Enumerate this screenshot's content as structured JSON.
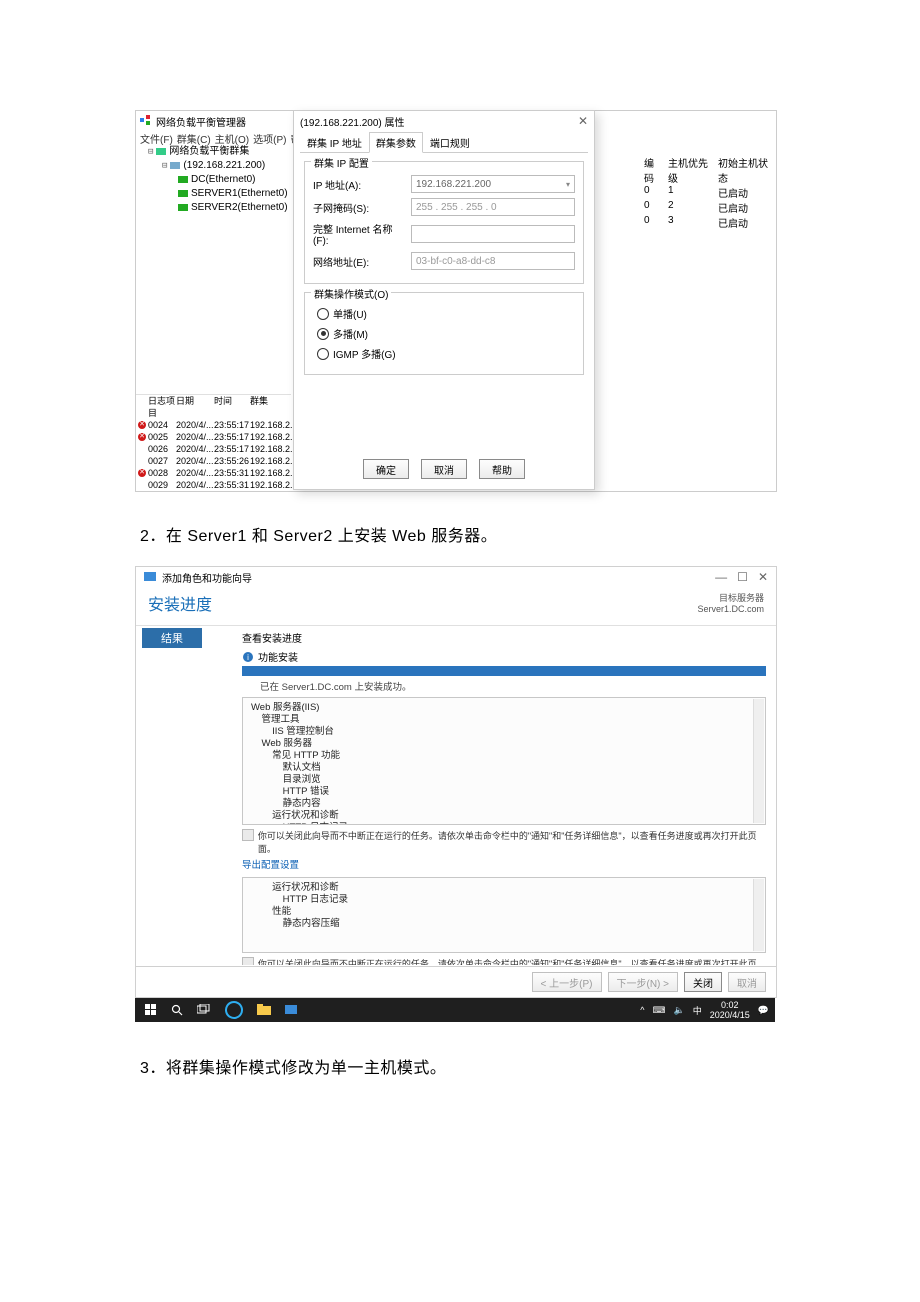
{
  "mgr": {
    "title": "网络负载平衡管理器",
    "menu": {
      "file": "文件(F)",
      "cluster": "群集(C)",
      "host": "主机(O)",
      "options": "选项(P)",
      "help": "帮助(H)"
    },
    "sys": {
      "min": "—",
      "max": "☐"
    },
    "tree": {
      "root": "网络负载平衡群集",
      "cluster_ip": "(192.168.221.200)",
      "hosts": [
        "DC(Ethernet0)",
        "SERVER1(Ethernet0)",
        "SERVER2(Ethernet0)"
      ]
    },
    "host_table": {
      "headers": {
        "code": "编码",
        "priority": "主机优先级",
        "status": "初始主机状态"
      },
      "rows": [
        {
          "code": "0",
          "priority": "1",
          "status": "已启动"
        },
        {
          "code": "0",
          "priority": "2",
          "status": "已启动"
        },
        {
          "code": "0",
          "priority": "3",
          "status": "已启动"
        }
      ]
    },
    "log": {
      "headers": {
        "entry": "日志项目",
        "date": "日期",
        "time": "时间",
        "cluster": "群集"
      },
      "rows": [
        {
          "err": true,
          "entry": "0024",
          "date": "2020/4/...",
          "time": "23:55:17",
          "cluster": "192.168.2..."
        },
        {
          "err": true,
          "entry": "0025",
          "date": "2020/4/...",
          "time": "23:55:17",
          "cluster": "192.168.2..."
        },
        {
          "err": false,
          "entry": "0026",
          "date": "2020/4/...",
          "time": "23:55:17",
          "cluster": "192.168.2..."
        },
        {
          "err": false,
          "entry": "0027",
          "date": "2020/4/...",
          "time": "23:55:26",
          "cluster": "192.168.2..."
        },
        {
          "err": true,
          "entry": "0028",
          "date": "2020/4/...",
          "time": "23:55:31",
          "cluster": "192.168.2..."
        },
        {
          "err": false,
          "entry": "0029",
          "date": "2020/4/...",
          "time": "23:55:31",
          "cluster": "192.168.2..."
        }
      ]
    }
  },
  "propdlg": {
    "title": "(192.168.221.200) 属性",
    "tabs": {
      "ip": "群集 IP 地址",
      "params": "群集参数",
      "rules": "端口规则"
    },
    "grp_ip": {
      "legend": "群集 IP 配置",
      "ip_label": "IP 地址(A):",
      "ip_value": "192.168.221.200",
      "mask_label": "子网掩码(S):",
      "mask_value": "255 . 255 . 255 .  0",
      "fqdn_label": "完整 Internet 名称(F):",
      "fqdn_value": "",
      "mac_label": "网络地址(E):",
      "mac_value": "03-bf-c0-a8-dd-c8"
    },
    "grp_mode": {
      "legend": "群集操作模式(O)",
      "unicast": "单播(U)",
      "multicast": "多播(M)",
      "igmp": "IGMP 多播(G)"
    },
    "buttons": {
      "ok": "确定",
      "cancel": "取消",
      "help": "帮助"
    }
  },
  "instr2": "2．在 Server1 和 Server2 上安装 Web 服务器。",
  "wizard": {
    "window_title": "添加角色和功能向导",
    "head_title": "安装进度",
    "dest_label": "目标服务器",
    "dest_value": "Server1.DC.com",
    "side_result": "结果",
    "view_progress": "查看安装进度",
    "feature_install": "功能安装",
    "success_msg": "已在 Server1.DC.com 上安装成功。",
    "features_text": "Web 服务器(IIS)\n    管理工具\n        IIS 管理控制台\n    Web 服务器\n        常见 HTTP 功能\n            默认文档\n            目录浏览\n            HTTP 错误\n            静态内容\n        运行状况和诊断\n            HTTP 日志记录\n        性能\n            静态内容压缩",
    "features_text_short": "        运行状况和诊断\n            HTTP 日志记录\n        性能\n            静态内容压缩",
    "note": "你可以关闭此向导而不中断正在运行的任务。请依次单击命令栏中的\"通知\"和\"任务详细信息\"，以查看任务进度或再次打开此页面。",
    "export_link": "导出配置设置",
    "buttons": {
      "prev": "< 上一步(P)",
      "next": "下一步(N) >",
      "close": "关闭",
      "cancel": "取消"
    }
  },
  "taskbar": {
    "ime": "中",
    "caret": "^",
    "tray1": "⌨",
    "tray2": "🔈",
    "time": "0:02",
    "date": "2020/4/15",
    "action": "💬"
  },
  "instr3": "3．将群集操作模式修改为单一主机模式。"
}
